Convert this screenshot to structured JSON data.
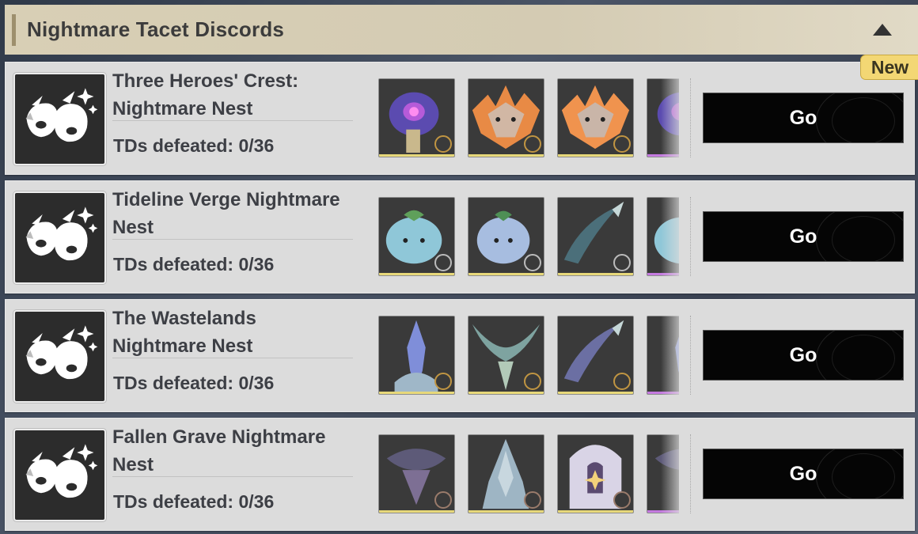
{
  "section": {
    "title": "Nightmare Tacet Discords",
    "badge": "New"
  },
  "rows": [
    {
      "title": "Three Heroes' Crest: Nightmare Nest",
      "progress": "TDs defeated: 0/36",
      "go_label": "Go",
      "thumbs": [
        "purple-flower-creature",
        "orange-spiked-dragon",
        "orange-spiked-dragon",
        "purple-flower-creature"
      ]
    },
    {
      "title": "Tideline Verge Nightmare Nest",
      "progress": "TDs defeated: 0/36",
      "go_label": "Go",
      "thumbs": [
        "blue-puffer-creature",
        "round-spirit-creature",
        "scythe-creature",
        "blue-puffer-creature"
      ]
    },
    {
      "title": "The Wastelands Nightmare Nest",
      "progress": "TDs defeated: 0/36",
      "go_label": "Go",
      "thumbs": [
        "crystal-humanoid",
        "antler-beast",
        "scythe-creature",
        "crystal-humanoid"
      ]
    },
    {
      "title": "Fallen Grave Nightmare Nest",
      "progress": "TDs defeated: 0/36",
      "go_label": "Go",
      "thumbs": [
        "dark-mushroom-creature",
        "pale-spire-creature",
        "white-crowned-boss",
        "dark-mushroom-creature"
      ]
    }
  ],
  "colors": {
    "header_bg": "#d8cfb5",
    "row_bg": "#dcdcdc",
    "go_bg": "#050505",
    "badge_bg": "#f3d774"
  }
}
